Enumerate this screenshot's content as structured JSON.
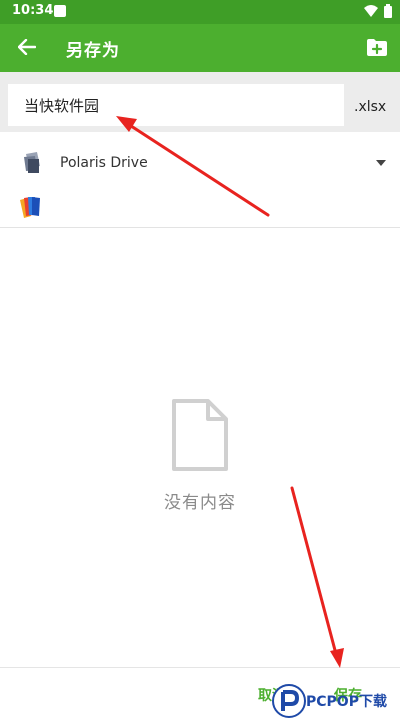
{
  "status_bar": {
    "time": "10:34"
  },
  "app_bar": {
    "title": "另存为"
  },
  "file_name": {
    "value": "当快软件园",
    "extension": ".xlsx"
  },
  "drive": {
    "name": "Polaris Drive"
  },
  "empty_state": {
    "message": "没有内容"
  },
  "actions": {
    "cancel_label": "取消",
    "save_label": "保存"
  },
  "watermark": {
    "text": "PCPOP下载"
  },
  "colors": {
    "toolbar": "#4caf2f",
    "status_bar": "#3f9e27",
    "accent": "#4caf2f",
    "annotation_arrow": "#e8231f"
  },
  "icons": [
    "back-arrow-icon",
    "new-folder-icon",
    "drive-icon",
    "app-logo-icon",
    "empty-file-icon",
    "wifi-icon",
    "battery-icon",
    "dropdown-arrow-icon"
  ]
}
